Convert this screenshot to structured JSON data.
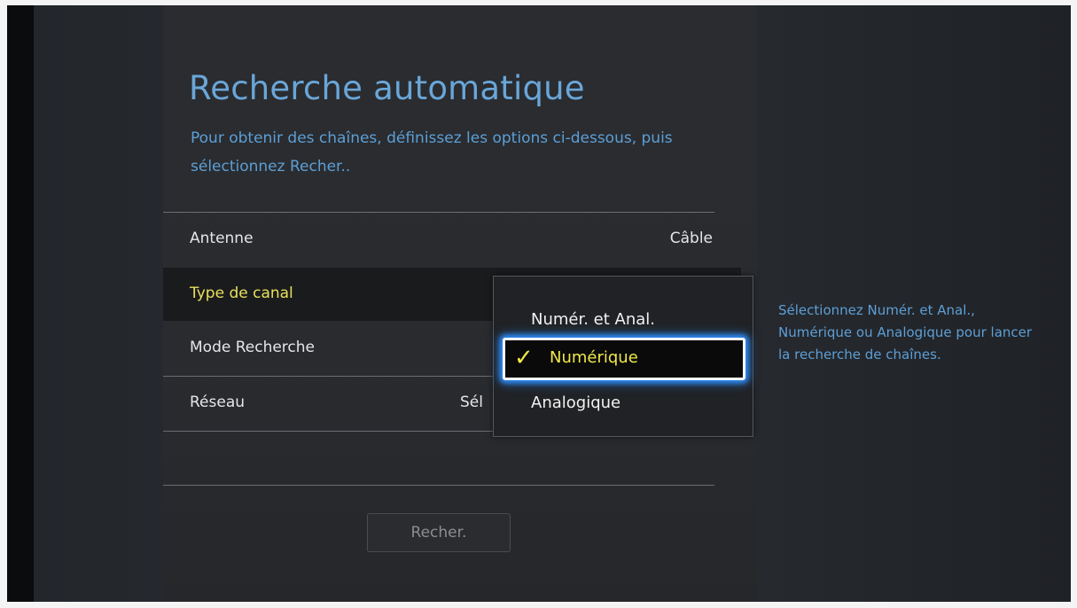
{
  "screen": {
    "title": "Recherche automatique",
    "subtitle": "Pour obtenir des chaînes, définissez les options ci-dessous, puis sélectionnez Recher.."
  },
  "settings": [
    {
      "label": "Antenne",
      "value": "Câble"
    },
    {
      "label": "Type de canal",
      "value": ""
    },
    {
      "label": "Mode Recherche",
      "value": ""
    },
    {
      "label": "Réseau",
      "value": "Sél"
    }
  ],
  "search_button": {
    "label": "Recher."
  },
  "dropdown": {
    "options": [
      "Numér. et Anal.",
      "Numérique",
      "Analogique"
    ],
    "selected": "Numérique",
    "check_glyph": "✓"
  },
  "help": {
    "text": "Sélectionnez Numér. et Anal., Numérique ou Analogique pour lancer la recherche de chaînes."
  },
  "colors": {
    "title_blue": "#6aa6d8",
    "selection_yellow": "#e8e05a",
    "focus_glow": "#2e8fff"
  }
}
